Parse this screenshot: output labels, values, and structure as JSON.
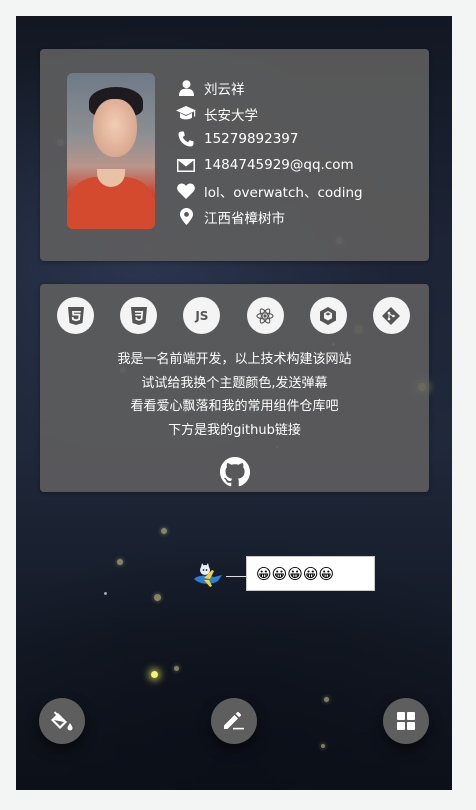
{
  "profile": {
    "name": "刘云祥",
    "school": "长安大学",
    "phone": "15279892397",
    "email": "1484745929@qq.com",
    "hobbies": "lol、overwatch、coding",
    "location": "江西省樟树市"
  },
  "skills": [
    {
      "name": "html5-icon",
      "glyph": "5"
    },
    {
      "name": "css3-icon",
      "glyph": "3"
    },
    {
      "name": "javascript-icon",
      "glyph": "JS"
    },
    {
      "name": "react-icon",
      "glyph": "⚛"
    },
    {
      "name": "webpack-icon",
      "glyph": "⬡"
    },
    {
      "name": "git-icon",
      "glyph": "◆"
    }
  ],
  "intro": {
    "line1": "我是一名前端开发，以上技术构建该网站",
    "line2": "试试给我换个主题颜色,发送弹幕",
    "line3": "看看爱心飘落和我的常用组件仓库吧",
    "line4": "下方是我的github链接"
  },
  "danmu": {
    "text": "😀😀😀😀😀"
  },
  "colors": {
    "card": "#5c5c5c",
    "fab": "#5e5e5e",
    "text": "#ffffff"
  }
}
